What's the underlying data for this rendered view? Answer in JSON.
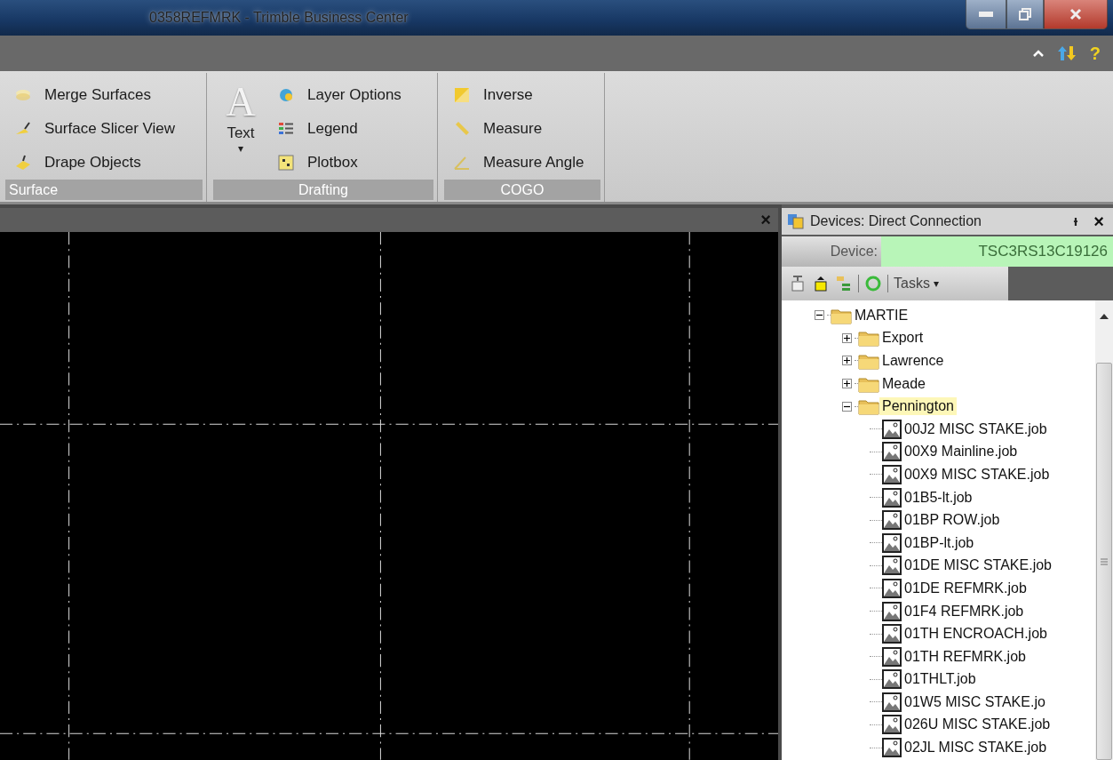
{
  "window": {
    "title": "0358REFMRK - Trimble Business Center"
  },
  "ribbon_bar": {
    "help": "?"
  },
  "ribbon": {
    "groups": [
      {
        "label": "Surface",
        "items": [
          {
            "label": "Merge Surfaces"
          },
          {
            "label": "Surface Slicer View"
          },
          {
            "label": "Drape Objects"
          }
        ]
      },
      {
        "label": "Drafting",
        "large": {
          "glyph": "A",
          "label": "Text",
          "caret": "▾"
        },
        "items": [
          {
            "label": "Layer Options"
          },
          {
            "label": "Legend"
          },
          {
            "label": "Plotbox"
          }
        ]
      },
      {
        "label": "COGO",
        "items": [
          {
            "label": "Inverse"
          },
          {
            "label": "Measure"
          },
          {
            "label": "Measure Angle"
          }
        ]
      }
    ]
  },
  "view": {
    "close": "×"
  },
  "devices_panel": {
    "title": "Devices: Direct Connection",
    "pin": "ᵼ",
    "close": "×",
    "device_label": "Device:",
    "device_value": "TSC3RS13C19126",
    "tasks": "Tasks",
    "tasks_caret": "▾",
    "tree": [
      {
        "label": "MARTIE",
        "kind": "folder",
        "expanded": true,
        "selected": false,
        "children": [
          {
            "label": "Export",
            "kind": "folder",
            "expanded": false,
            "selected": false
          },
          {
            "label": "Lawrence",
            "kind": "folder",
            "expanded": false,
            "selected": false
          },
          {
            "label": "Meade",
            "kind": "folder",
            "expanded": false,
            "selected": false
          },
          {
            "label": "Pennington",
            "kind": "folder",
            "expanded": true,
            "selected": true,
            "children": [
              {
                "label": "00J2 MISC STAKE.job",
                "kind": "file",
                "selected": false
              },
              {
                "label": "00X9 Mainline.job",
                "kind": "file",
                "selected": false
              },
              {
                "label": "00X9 MISC STAKE.job",
                "kind": "file",
                "selected": false
              },
              {
                "label": "01B5-lt.job",
                "kind": "file",
                "selected": false
              },
              {
                "label": "01BP ROW.job",
                "kind": "file",
                "selected": false
              },
              {
                "label": "01BP-lt.job",
                "kind": "file",
                "selected": false
              },
              {
                "label": "01DE MISC STAKE.job",
                "kind": "file",
                "selected": false
              },
              {
                "label": "01DE REFMRK.job",
                "kind": "file",
                "selected": false
              },
              {
                "label": "01F4 REFMRK.job",
                "kind": "file",
                "selected": false
              },
              {
                "label": "01TH ENCROACH.job",
                "kind": "file",
                "selected": false
              },
              {
                "label": "01TH REFMRK.job",
                "kind": "file",
                "selected": false
              },
              {
                "label": "01THLT.job",
                "kind": "file",
                "selected": false
              },
              {
                "label": "01W5 MISC STAKE.jo",
                "kind": "file",
                "selected": false
              },
              {
                "label": "026U MISC STAKE.job",
                "kind": "file",
                "selected": false
              },
              {
                "label": "02JL MISC STAKE.job",
                "kind": "file",
                "selected": false
              }
            ]
          }
        ]
      }
    ]
  }
}
